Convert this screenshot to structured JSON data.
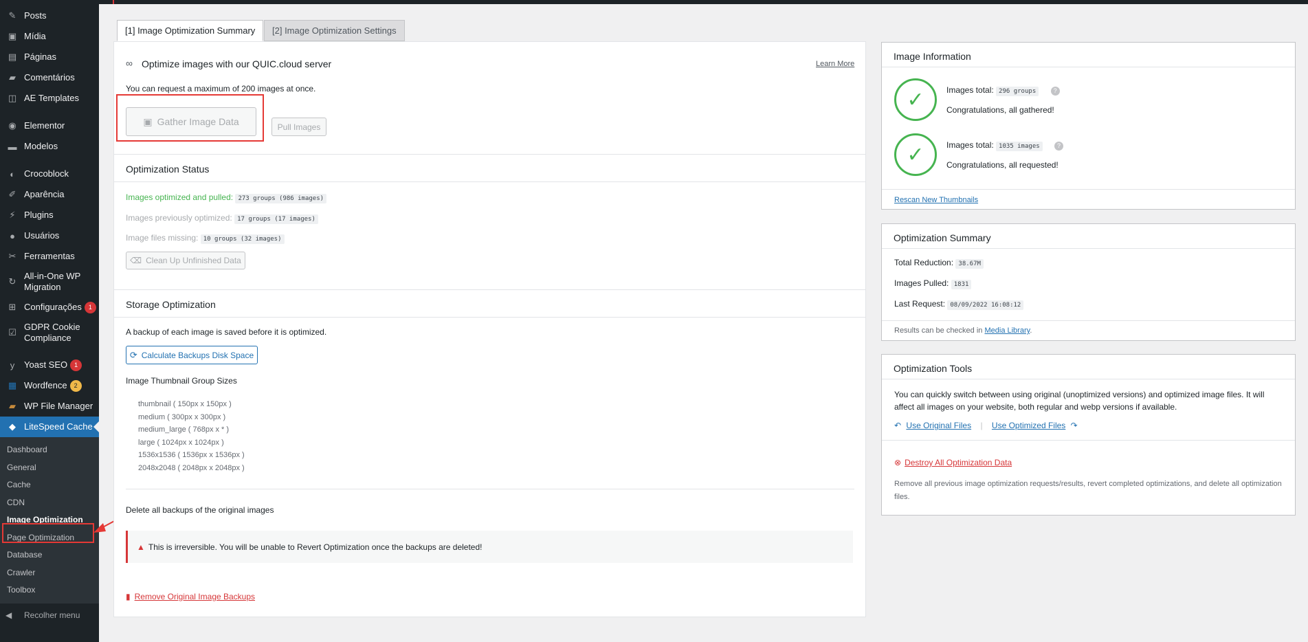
{
  "sidebar": {
    "items": [
      {
        "label": "Posts",
        "icon": "pin-icon"
      },
      {
        "label": "Mídia",
        "icon": "media-icon"
      },
      {
        "label": "Páginas",
        "icon": "page-icon"
      },
      {
        "label": "Comentários",
        "icon": "comment-icon"
      },
      {
        "label": "AE Templates",
        "icon": "ae-icon"
      },
      {
        "label": "Elementor",
        "icon": "elementor-icon"
      },
      {
        "label": "Modelos",
        "icon": "folder-icon"
      },
      {
        "label": "Crocoblock",
        "icon": "crocoblock-icon"
      },
      {
        "label": "Aparência",
        "icon": "brush-icon"
      },
      {
        "label": "Plugins",
        "icon": "plugin-icon"
      },
      {
        "label": "Usuários",
        "icon": "user-icon"
      },
      {
        "label": "Ferramentas",
        "icon": "wrench-icon"
      },
      {
        "label": "All-in-One WP Migration",
        "icon": "migration-icon"
      },
      {
        "label": "Configurações",
        "icon": "settings-icon",
        "badge": "1"
      },
      {
        "label": "GDPR Cookie Compliance",
        "icon": "gdpr-icon"
      },
      {
        "label": "Yoast SEO",
        "icon": "yoast-icon",
        "badge": "1"
      },
      {
        "label": "Wordfence",
        "icon": "wordfence-icon",
        "badge": "2"
      },
      {
        "label": "WP File Manager",
        "icon": "file-manager-icon"
      },
      {
        "label": "LiteSpeed Cache",
        "icon": "litespeed-icon"
      }
    ],
    "submenu": [
      "Dashboard",
      "General",
      "Cache",
      "CDN",
      "Image Optimization",
      "Page Optimization",
      "Database",
      "Crawler",
      "Toolbox"
    ],
    "collapse_label": "Recolher menu"
  },
  "tabs": [
    "[1] Image Optimization Summary",
    "[2] Image Optimization Settings"
  ],
  "optimize": {
    "title": "Optimize images with our QUIC.cloud server",
    "learn_more": "Learn More",
    "limit_text": "You can request a maximum of 200 images at once.",
    "gather_button": "Gather Image Data",
    "pull_button": "Pull Images"
  },
  "status": {
    "title": "Optimization Status",
    "optimized_label": "Images optimized and pulled:",
    "optimized_value": "273 groups (986 images)",
    "previous_label": "Images previously optimized:",
    "previous_value": "17 groups (17 images)",
    "missing_label": "Image files missing:",
    "missing_value": "10 groups (32 images)",
    "cleanup_button": "Clean Up Unfinished Data"
  },
  "storage": {
    "title": "Storage Optimization",
    "backup_text": "A backup of each image is saved before it is optimized.",
    "calc_button": "Calculate Backups Disk Space",
    "sizes_title": "Image Thumbnail Group Sizes",
    "sizes": [
      "thumbnail ( 150px x 150px )",
      "medium ( 300px x 300px )",
      "medium_large ( 768px x * )",
      "large ( 1024px x 1024px )",
      "1536x1536 ( 1536px x 1536px )",
      "2048x2048 ( 2048px x 2048px )"
    ],
    "delete_title": "Delete all backups of the original images",
    "warning": "This is irreversible. You will be unable to Revert Optimization once the backups are deleted!",
    "remove_link": "Remove Original Image Backups"
  },
  "image_info": {
    "title": "Image Information",
    "total_label": "Images total:",
    "groups_value": "296 groups",
    "gathered_text": "Congratulations, all gathered!",
    "images_value": "1035 images",
    "requested_text": "Congratulations, all requested!",
    "rescan_link": "Rescan New Thumbnails"
  },
  "summary": {
    "title": "Optimization Summary",
    "reduction_label": "Total Reduction:",
    "reduction_value": "38.67M",
    "pulled_label": "Images Pulled:",
    "pulled_value": "1831",
    "last_label": "Last Request:",
    "last_value": "08/09/2022 16:08:12",
    "results_text": "Results can be checked in",
    "media_library": "Media Library",
    "period": "."
  },
  "tools": {
    "title": "Optimization Tools",
    "description": "You can quickly switch between using original (unoptimized versions) and optimized image files. It will affect all images on your website, both regular and webp versions if available.",
    "use_original": "Use Original Files",
    "use_optimized": "Use Optimized Files",
    "separator": "|",
    "destroy_link": "Destroy All Optimization Data",
    "destroy_desc": "Remove all previous image optimization requests/results, revert completed optimizations, and delete all optimization files."
  },
  "colors": {
    "accent": "#2271b1",
    "sidebar_bg": "#1d2327",
    "success": "#46b450",
    "danger": "#d63638",
    "highlight": "#e53935"
  }
}
